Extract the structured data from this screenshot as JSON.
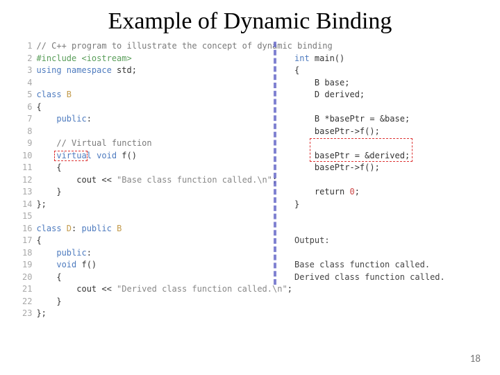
{
  "title": "Example of Dynamic Binding",
  "page_number": "18",
  "line_count": 23,
  "code_left": {
    "l1_comment": "// C++ program to illustrate the concept of dynamic binding",
    "l2_include": "#include <iostream>",
    "l3_a": "using",
    "l3_b": " namespace",
    "l3_c": " std;",
    "l5_a": "class",
    "l5_b": " B",
    "l6": "{",
    "l7_a": "    public",
    "l7_b": ":",
    "l9_comment": "    // Virtual function",
    "l10_a": "    virtual",
    "l10_b": " void",
    "l10_c": " f()",
    "l11": "    {",
    "l12_a": "        cout << ",
    "l12_b": "\"Base class function called.\\n\"",
    "l12_c": ";",
    "l13": "    }",
    "l14": "};",
    "l16_a": "class",
    "l16_b": " D",
    "l16_c": ": ",
    "l16_d": "public",
    "l16_e": " B",
    "l17": "{",
    "l18_a": "    public",
    "l18_b": ":",
    "l19_a": "    void",
    "l19_b": " f()",
    "l20": "    {",
    "l21_a": "        cout << ",
    "l21_b": "\"Derived class function called.\\n\"",
    "l21_c": ";",
    "l22": "    }",
    "l23": "};"
  },
  "code_right": {
    "r1_a": "int",
    "r1_b": " main()",
    "r2": "{",
    "r3": "    B base;",
    "r4": "    D derived;",
    "r6": "    B *basePtr = &base;",
    "r7": "    basePtr->f();",
    "r9": "    basePtr = &derived;",
    "r10": "    basePtr->f();",
    "r12_a": "    return ",
    "r12_b": "0",
    "r12_c": ";",
    "r13": "}",
    "out_label": "Output:",
    "out1": "Base class function called.",
    "out2": "Derived class function called."
  }
}
